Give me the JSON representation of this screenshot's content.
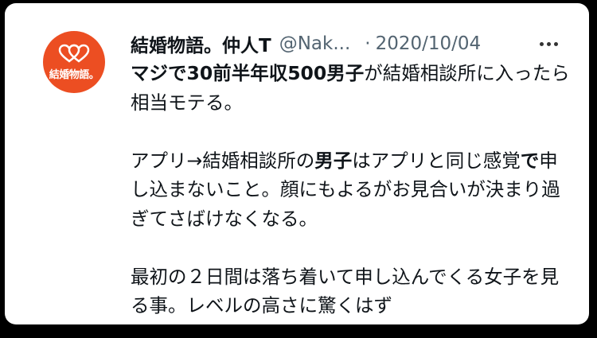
{
  "tweet": {
    "display_name": "結婚物語。仲人T",
    "handle": "@Nak...",
    "separator": "·",
    "date": "2020/10/04",
    "avatar": {
      "icon": "double-heart-icon",
      "text": "結婚物語。",
      "bg_color": "#ec4e22"
    },
    "paragraphs": [
      {
        "segments": [
          {
            "text": "マジで30前半年収500男子",
            "bold": true
          },
          {
            "text": "が結婚相談所に入ったら相当モテる。",
            "bold": false
          }
        ]
      },
      {
        "segments": [
          {
            "text": "アプリ→結婚相談所の",
            "bold": false
          },
          {
            "text": "男子",
            "bold": true
          },
          {
            "text": "はアプリと同じ感覚",
            "bold": false
          },
          {
            "text": "で",
            "bold": true
          },
          {
            "text": "申し込まないこと。顔にもよるがお見合いが決まり過ぎてさばけなくなる。",
            "bold": false
          }
        ]
      },
      {
        "segments": [
          {
            "text": "最初の２日間は落ち着いて申し込んでくる女子を見る事。レベルの高さに驚くはず",
            "bold": false
          }
        ]
      }
    ]
  }
}
